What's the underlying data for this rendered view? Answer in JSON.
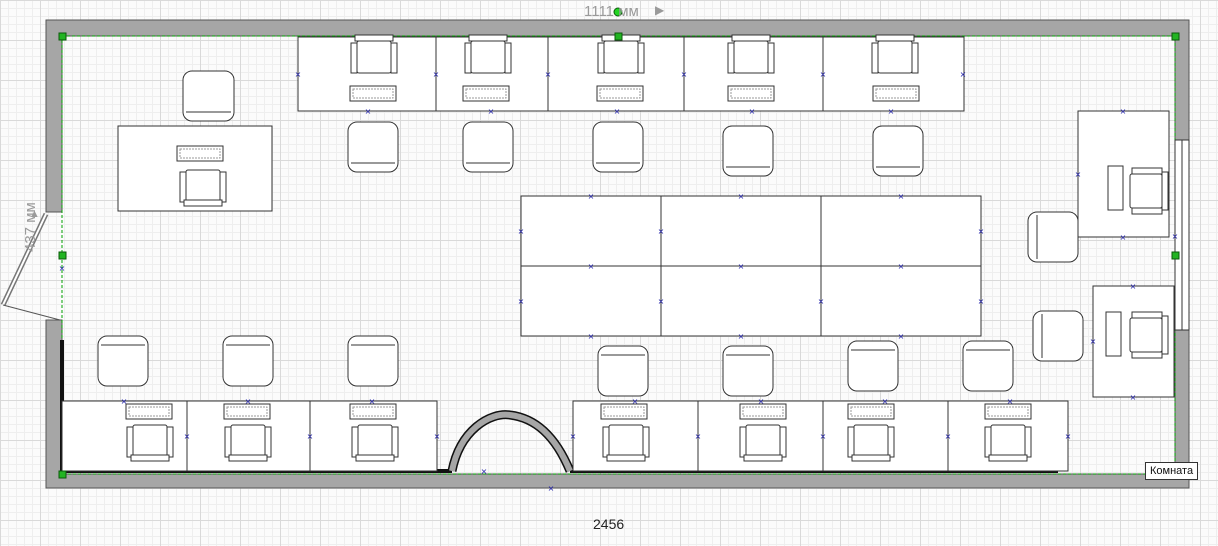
{
  "plan": {
    "width_label": "1111 мм",
    "width_arrow": "▶",
    "height_label": "437 мм",
    "height_arrow": "▲",
    "bottom_label": "2456",
    "room_label": "Комната"
  },
  "colors": {
    "wall": "#a6a6a6",
    "wall_outline": "#555555",
    "thick_wall": "#111111",
    "furniture_stroke": "#333333",
    "selection": "#00a000",
    "handle": "#1a1aa8"
  },
  "furniture": {
    "desks": 22,
    "monitors": 18,
    "office_chairs": 18,
    "armchairs": 18,
    "meeting_tables": 6
  }
}
